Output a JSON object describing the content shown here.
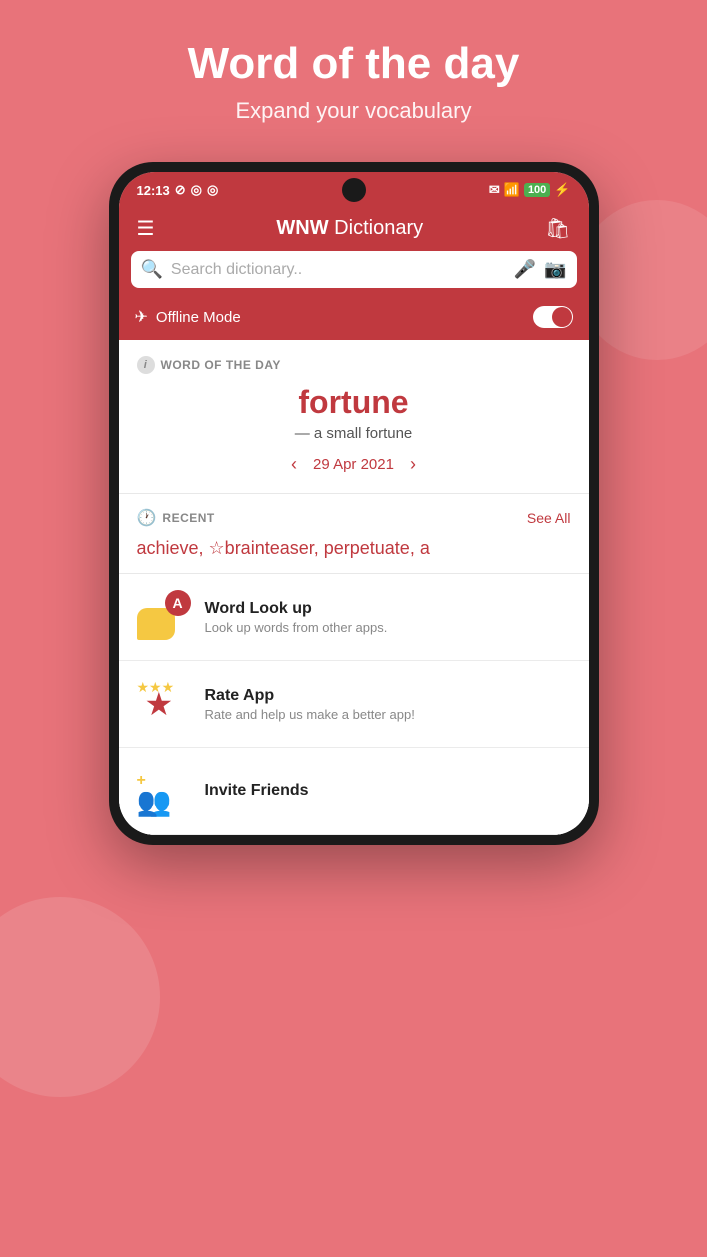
{
  "background_color": "#e8737a",
  "header": {
    "title": "Word of the day",
    "subtitle": "Expand your vocabulary"
  },
  "status_bar": {
    "time": "12:13",
    "battery": "100"
  },
  "app_bar": {
    "brand_bold": "WNW",
    "brand_regular": " Dictionary"
  },
  "search": {
    "placeholder": "Search dictionary.."
  },
  "offline": {
    "label": "Offline Mode"
  },
  "word_of_day": {
    "section_label": "WORD OF THE DAY",
    "word": "fortune",
    "definition": "— a small fortune",
    "date": "29 Apr 2021"
  },
  "recent": {
    "section_label": "RECENT",
    "see_all": "See All",
    "words": "achieve, ☆brainteaser, perpetuate, a"
  },
  "features": [
    {
      "title": "Word Look up",
      "description": "Look up words from other apps.",
      "icon_type": "lookup"
    },
    {
      "title": "Rate App",
      "description": "Rate and help us make a better app!",
      "icon_type": "rate"
    },
    {
      "title": "Invite Friends",
      "description": "",
      "icon_type": "invite"
    }
  ]
}
